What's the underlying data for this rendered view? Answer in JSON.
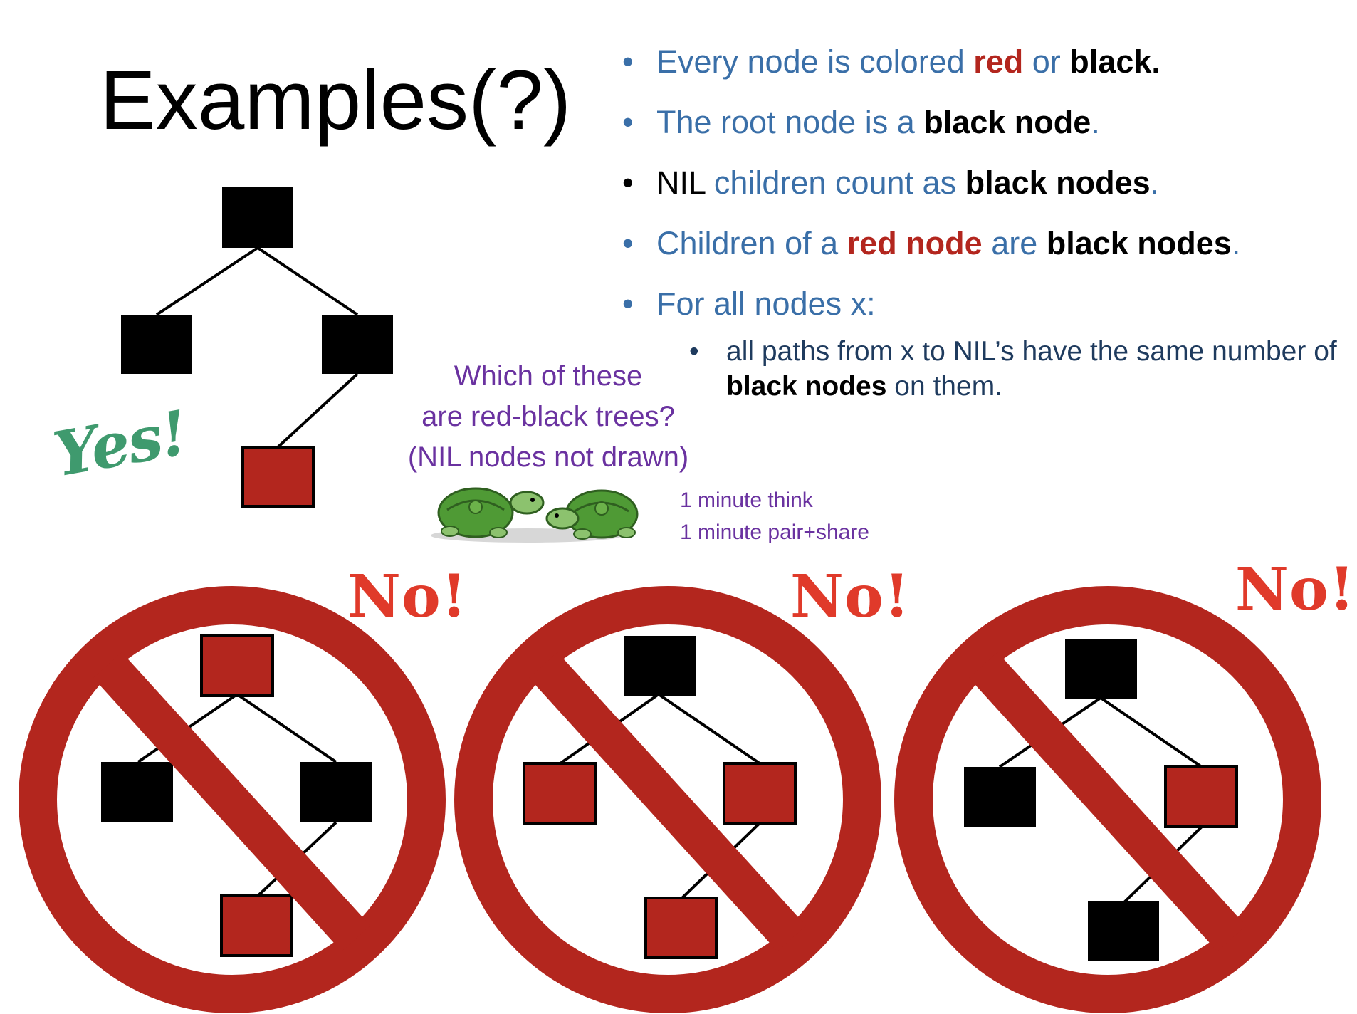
{
  "title": "Examples(?)",
  "bullets": {
    "b1": {
      "pre": "Every node is colored ",
      "red": "red",
      "mid": " or ",
      "black": "black."
    },
    "b2": {
      "pre": "The root node is a ",
      "black": "black node",
      "post": "."
    },
    "b3": {
      "nil": "NIL",
      "pre": " children count as ",
      "black": "black nodes",
      "post": "."
    },
    "b4": {
      "pre": "Children of a ",
      "red": "red node",
      "mid": " are ",
      "black": "black nodes",
      "post": "."
    },
    "b5": {
      "text": "For all nodes x:"
    },
    "sub": {
      "pre": "all paths from x to NIL’s have the same number of ",
      "black": "black nodes",
      "post": " on them."
    }
  },
  "question": {
    "line1": "Which of these",
    "line2": "are red-black trees?",
    "line3": "(NIL nodes not drawn)"
  },
  "timing": {
    "line1": "1 minute think",
    "line2": "1 minute pair+share"
  },
  "verdicts": {
    "yes": "Yes!",
    "no1": "No!",
    "no2": "No!",
    "no3": "No!"
  },
  "colors": {
    "red_node": "#b3261e",
    "black_node": "#000000",
    "prohibition": "#b3261e",
    "text_blue": "#3a6fa8",
    "question_purple": "#6a32a0",
    "yes_green": "#3f9a6e",
    "no_red": "#e03a2a"
  },
  "trees": [
    {
      "verdict": "Yes!",
      "root": "black",
      "left": "black",
      "right": "black",
      "right_child": "red",
      "crossed": false
    },
    {
      "verdict": "No!",
      "root": "red",
      "left": "black",
      "right": "black",
      "right_child": "red",
      "crossed": true
    },
    {
      "verdict": "No!",
      "root": "black",
      "left": "red",
      "right": "red",
      "right_child": "red",
      "crossed": true
    },
    {
      "verdict": "No!",
      "root": "black",
      "left": "black",
      "right": "red",
      "right_child": "black",
      "crossed": true
    }
  ],
  "icons": {
    "turtles": "two-turtles-icon",
    "prohibition": "prohibition-sign-icon"
  }
}
